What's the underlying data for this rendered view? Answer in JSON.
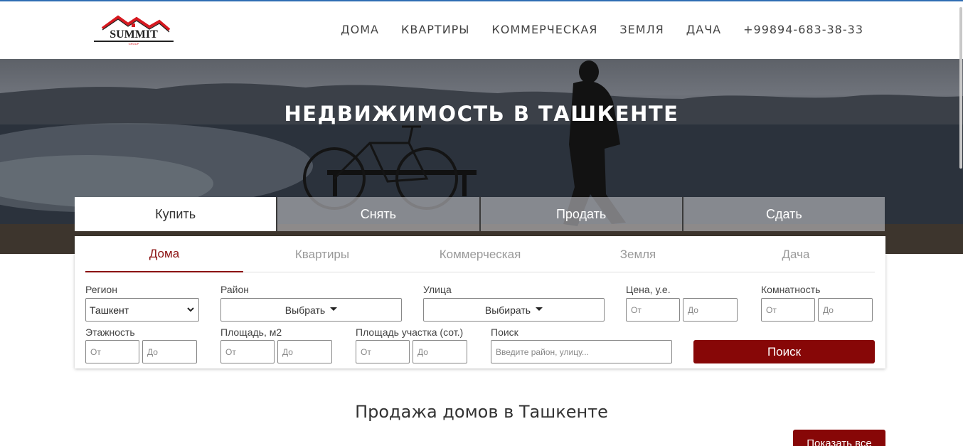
{
  "brand": {
    "logo_text": "SUMMIT",
    "logo_sub": "GROUP",
    "accent": "#870707",
    "logo_red": "#d71920"
  },
  "nav": {
    "items": [
      "ДОМА",
      "КВАРТИРЫ",
      "КОММЕРЧЕСКАЯ",
      "ЗЕМЛЯ",
      "ДАЧА"
    ],
    "phone": "+99894-683-38-33"
  },
  "hero": {
    "title": "НЕДВИЖИМОСТЬ В ТАШКЕНТЕ"
  },
  "deal_tabs": [
    "Купить",
    "Снять",
    "Продать",
    "Сдать"
  ],
  "type_tabs": [
    "Дома",
    "Квартиры",
    "Коммерческая",
    "Земля",
    "Дача"
  ],
  "filters": {
    "region": {
      "label": "Регион",
      "value": "Ташкент"
    },
    "district": {
      "label": "Район",
      "value": "Выбрать"
    },
    "street": {
      "label": "Улица",
      "value": "Выбирать"
    },
    "price": {
      "label": "Цена, у.е.",
      "from": "От",
      "to": "До"
    },
    "rooms": {
      "label": "Комнатность",
      "from": "От",
      "to": "До"
    },
    "floors": {
      "label": "Этажность",
      "from": "От",
      "to": "До"
    },
    "area": {
      "label": "Площадь, м2",
      "from": "От",
      "to": "До"
    },
    "plot": {
      "label": "Площадь участка (сот.)",
      "from": "От",
      "to": "До"
    },
    "search": {
      "label": "Поиск",
      "placeholder": "Введите район, улицу..."
    },
    "submit": "Поиск"
  },
  "section": {
    "title": "Продажа домов в Ташкенте",
    "show_all": "Показать все"
  }
}
